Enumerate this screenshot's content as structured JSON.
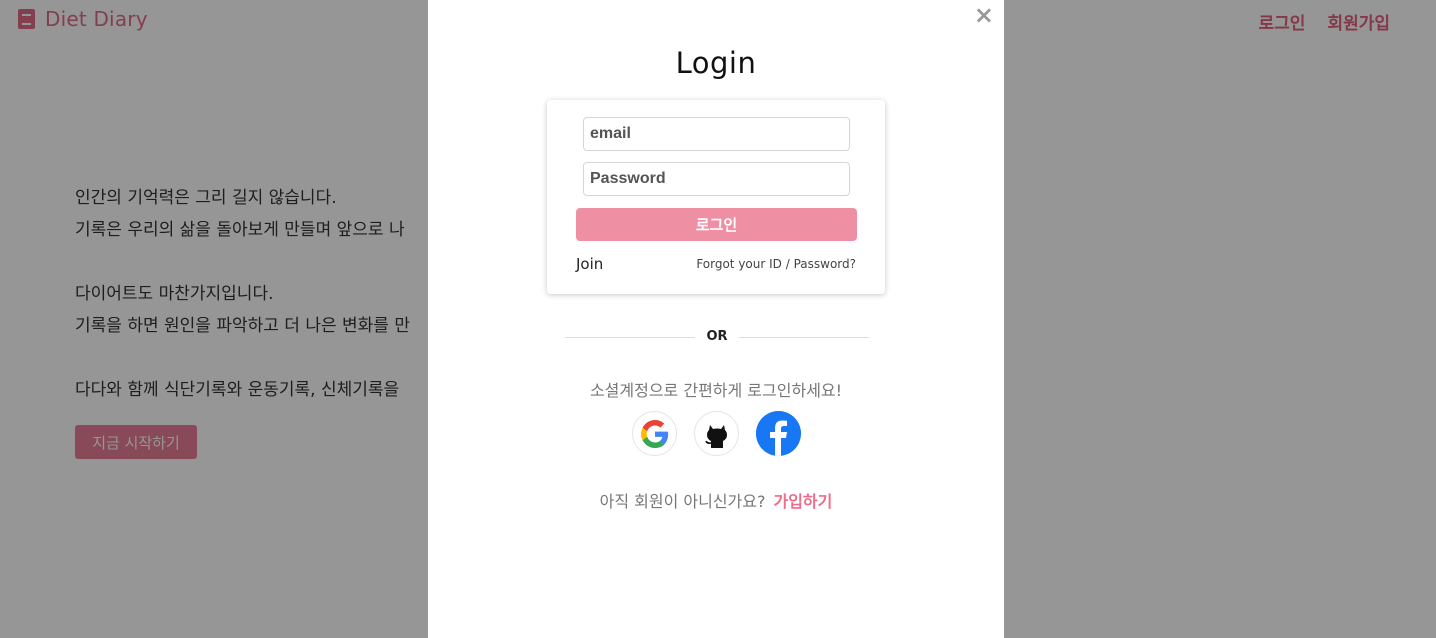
{
  "header": {
    "brand_name": "Diet Diary",
    "brand_icon": "book-icon",
    "nav": {
      "login": "로그인",
      "signup": "회원가입"
    }
  },
  "hero": {
    "line1": "인간의 기억력은 그리 길지 않습니다.",
    "line2": "기록은 우리의 삶을 돌아보게 만들며 앞으로 나",
    "line3": "다이어트도 마찬가지입니다.",
    "line4": "기록을 하면 원인을 파악하고 더 나은 변화를 만",
    "line5": "다다와 함께 식단기록와 운동기록, 신체기록을",
    "start_button": "지금 시작하기"
  },
  "modal": {
    "close_symbol": "×",
    "title": "Login",
    "email_placeholder": "email",
    "password_placeholder": "Password",
    "login_button": "로그인",
    "join_link": "Join",
    "forgot_link": "Forgot your ID / Password?",
    "divider_text": "OR",
    "social_text": "소셜계정으로 간편하게 로그인하세요!",
    "social_icons": [
      "google-icon",
      "github-icon",
      "facebook-icon"
    ],
    "signup_prompt": "아직 회원이 아니신가요?",
    "signup_link": "가입하기"
  },
  "colors": {
    "brand": "#e06b86",
    "login_button": "#ef8fa3",
    "signup_link": "#ef6c8a",
    "facebook": "#1877f2"
  }
}
